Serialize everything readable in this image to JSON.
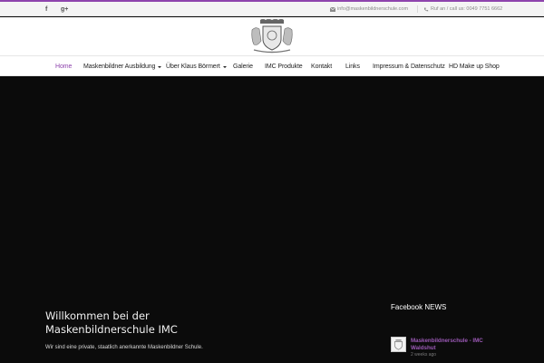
{
  "colors": {
    "accent": "#8e44ad",
    "hero_bg": "#0b0b0b",
    "topbar_bg": "#f4f4f4",
    "fb_link": "#9b59b6"
  },
  "topbar": {
    "social": [
      {
        "icon": "facebook-icon",
        "glyph": "f"
      },
      {
        "icon": "google-plus-icon",
        "glyph": "g+"
      }
    ],
    "email": "info@maskenbildnerschule.com",
    "phone": "Ruf an / call us: 0049 7751 6662"
  },
  "header": {
    "logo_icon": "school-crest-logo"
  },
  "nav": {
    "items": [
      {
        "label": "Home",
        "active": true,
        "dropdown": false
      },
      {
        "label": "Maskenbildner Ausbildung",
        "active": false,
        "dropdown": true
      },
      {
        "label": "Über Klaus Börmert",
        "active": false,
        "dropdown": true
      },
      {
        "label": "Galerie",
        "active": false,
        "dropdown": false
      },
      {
        "label": "IMC Produkte",
        "active": false,
        "dropdown": false
      },
      {
        "label": "Kontakt",
        "active": false,
        "dropdown": false
      },
      {
        "label": "Links",
        "active": false,
        "dropdown": false
      },
      {
        "label": "Impressum & Datenschutz",
        "active": false,
        "dropdown": false
      },
      {
        "label": "HD Make up Shop",
        "active": false,
        "dropdown": false
      }
    ]
  },
  "main": {
    "heading_line1": "Willkommen bei der",
    "heading_line2": "Maskenbildnerschule IMC",
    "intro": "Wir sind eine private, staatlich anerkannte Maskenbildner Schule."
  },
  "sidebar": {
    "title": "Facebook NEWS",
    "post": {
      "name": "Maskenbildnerschule - IMC Waldshut",
      "time": "2 weeks ago"
    }
  }
}
